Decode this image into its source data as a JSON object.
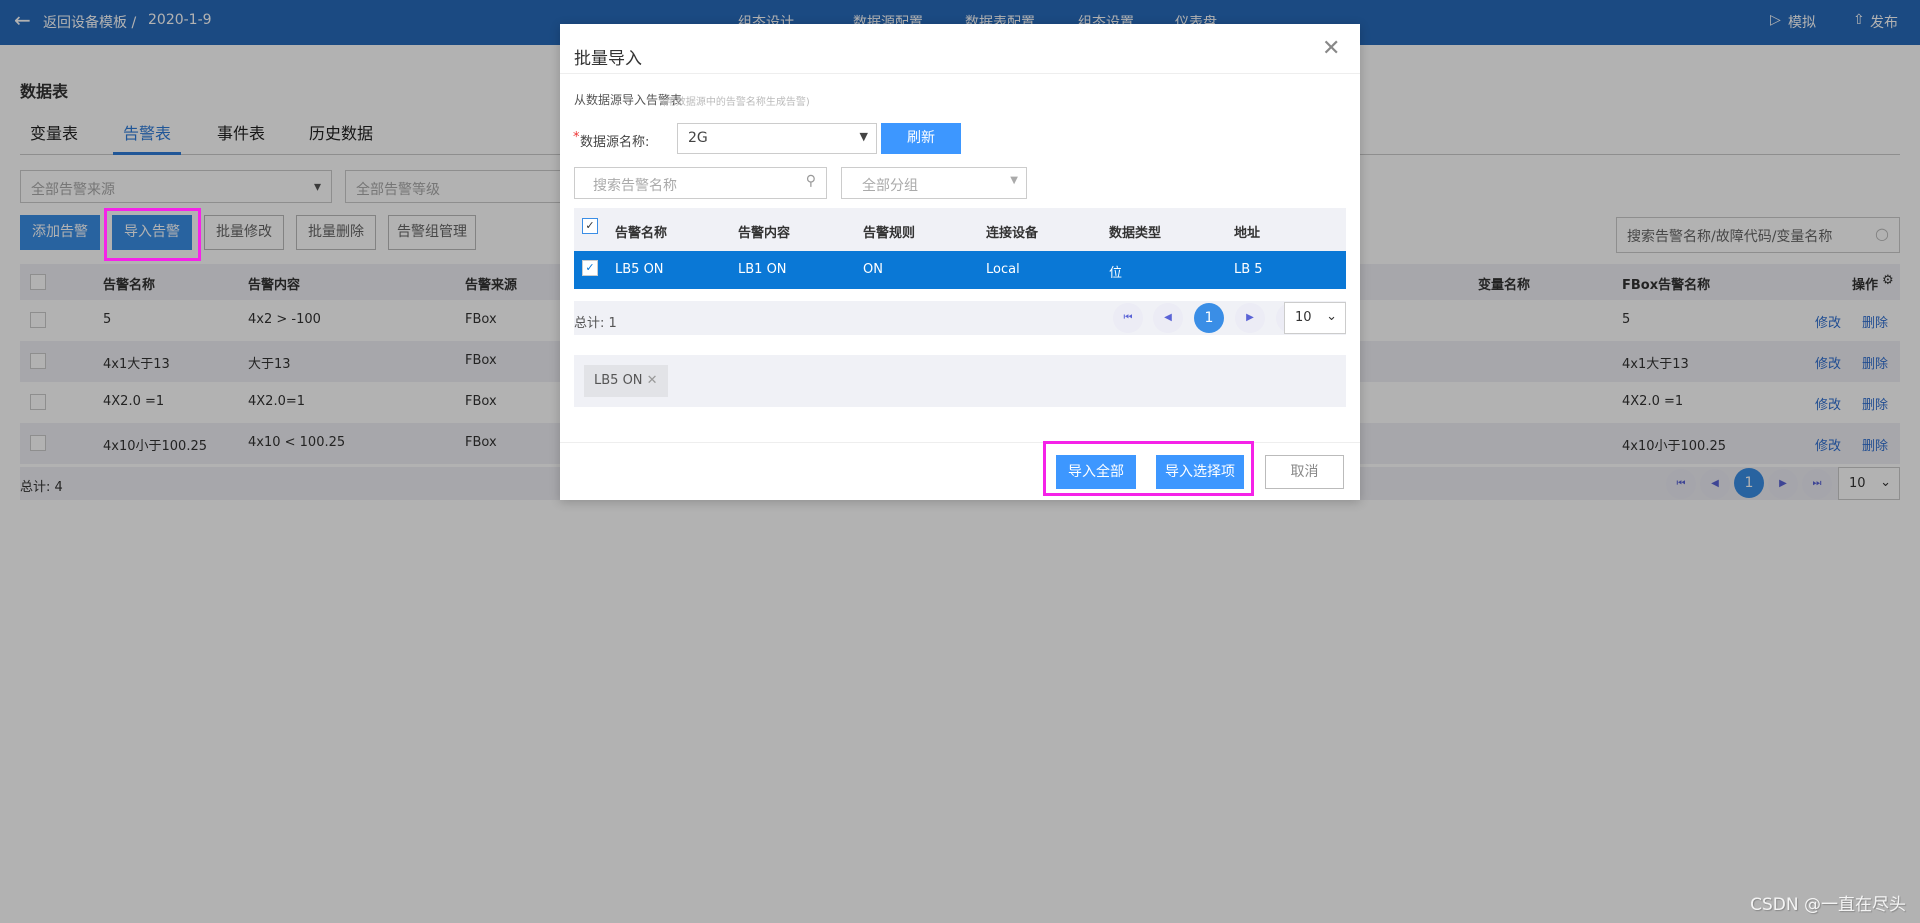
{
  "header": {
    "back_label": "返回设备模板 /",
    "template_date": "2020-1-9",
    "nav": [
      "组态设计",
      "数据源配置",
      "数据表配置",
      "组态设置",
      "仪表盘"
    ],
    "simulate": "模拟",
    "publish": "发布"
  },
  "page": {
    "title": "数据表",
    "tabs": [
      "变量表",
      "告警表",
      "事件表",
      "历史数据"
    ],
    "active_tab": "告警表",
    "filters": {
      "source_placeholder": "全部告警来源",
      "level_placeholder": "全部告警等级"
    },
    "buttons": {
      "add": "添加告警",
      "import": "导入告警",
      "batch_edit": "批量修改",
      "batch_delete": "批量删除",
      "group_manage": "告警组管理"
    },
    "search_placeholder": "搜索告警名称/故障代码/变量名称",
    "columns": {
      "name": "告警名称",
      "content": "告警内容",
      "source": "告警来源",
      "var_name": "变量名称",
      "fbox_name": "FBox告警名称",
      "ops": "操作"
    },
    "rows": [
      {
        "name": "5",
        "content": "4x2 > -100",
        "source": "FBox",
        "fbox_name": "5"
      },
      {
        "name": "4x1大于13",
        "content": "大于13",
        "source": "FBox",
        "fbox_name": "4x1大于13"
      },
      {
        "name": "4X2.0 =1",
        "content": "4X2.0=1",
        "source": "FBox",
        "fbox_name": "4X2.0 =1"
      },
      {
        "name": "4x10小于100.25",
        "content": "4x10 < 100.25",
        "source": "FBox",
        "fbox_name": "4x10小于100.25"
      }
    ],
    "edit": "修改",
    "delete": "删除",
    "total": "总计: 4",
    "current_page": "1",
    "page_size": "10"
  },
  "modal": {
    "title": "批量导入",
    "subtitle": "从数据源导入告警表",
    "hint": "(用数据源中的告警名称生成告警)",
    "ds_label": "数据源名称:",
    "ds_value": "2G",
    "refresh": "刷新",
    "search_placeholder": "搜索告警名称",
    "group_placeholder": "全部分组",
    "columns": [
      "告警名称",
      "告警内容",
      "告警规则",
      "连接设备",
      "数据类型",
      "地址"
    ],
    "rows": [
      [
        "LB5 ON",
        "LB1 ON",
        "ON",
        "Local",
        "位",
        "LB 5"
      ]
    ],
    "total": "总计: 1",
    "current_page": "1",
    "page_size": "10",
    "selected_tags": [
      "LB5 ON"
    ],
    "import_all": "导入全部",
    "import_selected": "导入选择项",
    "cancel": "取消"
  },
  "watermark": "CSDN @一直在尽头",
  "colors": {
    "header": "#286aba",
    "primary": "#3a8ee6",
    "selected_row": "#0a78d6",
    "highlight": "#f522e8"
  }
}
